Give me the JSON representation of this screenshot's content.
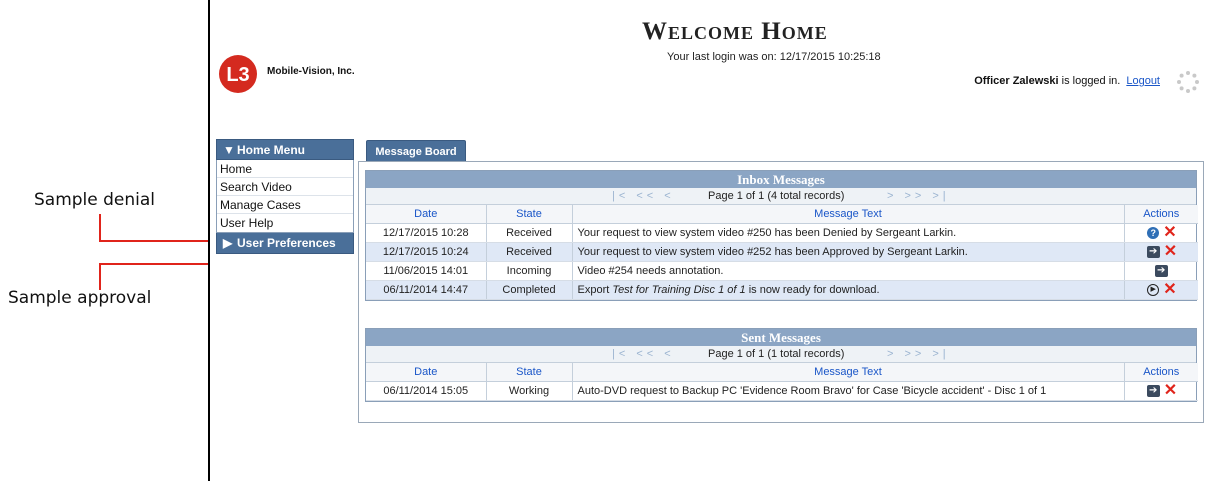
{
  "callouts": {
    "denial": "Sample denial",
    "approval": "Sample approval"
  },
  "header": {
    "company": "Mobile-Vision, Inc.",
    "title": "Welcome Home",
    "last_login": "Your last login was on: 12/17/2015 10:25:18",
    "user_name": "Officer Zalewski",
    "logged_in_suffix": " is logged in.",
    "logout_label": "Logout"
  },
  "menu": {
    "home_menu_label": "Home Menu",
    "items": [
      "Home",
      "Search Video",
      "Manage Cases",
      "User Help"
    ],
    "user_prefs_label": "User Preferences"
  },
  "tab_label": "Message Board",
  "inbox": {
    "title": "Inbox Messages",
    "page_info": "Page 1 of 1 (4 total records)",
    "nav_left": "|< << <",
    "nav_right": "> >> >|",
    "columns": [
      "Date",
      "State",
      "Message Text",
      "Actions"
    ],
    "rows": [
      {
        "date": "12/17/2015 10:28",
        "state": "Received",
        "text": "Your request to view system video #250 has been Denied by Sergeant Larkin.",
        "actions": [
          "help-icon",
          "delete-icon"
        ]
      },
      {
        "date": "12/17/2015 10:24",
        "state": "Received",
        "text": "Your request to view system video #252 has been Approved by Sergeant Larkin.",
        "actions": [
          "go-icon",
          "delete-icon"
        ]
      },
      {
        "date": "11/06/2015 14:01",
        "state": "Incoming",
        "text": "Video #254 needs annotation.",
        "actions": [
          "go-icon"
        ]
      },
      {
        "date": "06/11/2014 14:47",
        "state": "Completed",
        "text_prefix": "Export ",
        "text_italic": "Test for Training Disc 1 of 1",
        "text_suffix": " is now ready for download.",
        "actions": [
          "play-icon",
          "delete-icon"
        ]
      }
    ]
  },
  "sent": {
    "title": "Sent Messages",
    "page_info": "Page 1 of 1 (1 total records)",
    "nav_left": "|< << <",
    "nav_right": "> >> >|",
    "columns": [
      "Date",
      "State",
      "Message Text",
      "Actions"
    ],
    "rows": [
      {
        "date": "06/11/2014 15:05",
        "state": "Working",
        "text": "Auto-DVD request to Backup PC 'Evidence Room Bravo' for Case 'Bicycle accident' - Disc 1 of 1",
        "actions": [
          "go-icon",
          "delete-icon"
        ]
      }
    ]
  },
  "colors": {
    "accent": "#4a6f99",
    "header_band": "#8ba5c4",
    "alt_row": "#dfe8f6",
    "link": "#1a56c8",
    "delete": "#e0241b",
    "arrow": "#e0241b"
  }
}
